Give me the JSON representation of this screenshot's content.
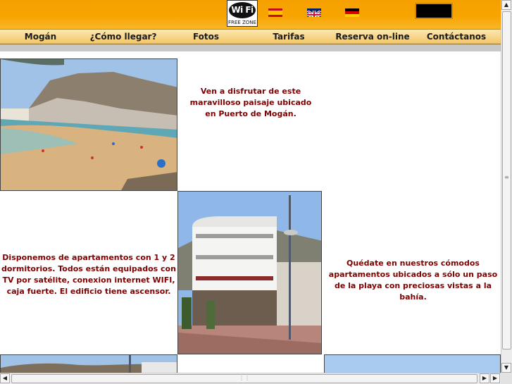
{
  "header": {
    "wifi": {
      "logo_text": "Wi Fi",
      "label": "FREE ZONE"
    },
    "languages": [
      {
        "name": "flag-spain-icon",
        "lang": "es"
      },
      {
        "name": "flag-uk-icon",
        "lang": "en"
      },
      {
        "name": "flag-germany-icon",
        "lang": "de"
      }
    ]
  },
  "nav": {
    "items": [
      {
        "label": "Mogán"
      },
      {
        "label": "¿Cómo llegar?"
      },
      {
        "label": "Fotos"
      },
      {
        "label": "Tarifas"
      },
      {
        "label": "Reserva on-line"
      },
      {
        "label": "Contáctanos"
      }
    ]
  },
  "content": {
    "intro": "Ven a disfrutar de este maravilloso paisaje ubicado en Puerto de Mogán.",
    "apartments": "Disponemos de apartamentos con 1 y 2 dormitorios. Todos están equipados con TV por satélite, conexion internet WIFI, caja fuerte. El edificio tiene ascensor.",
    "stay": "Quédate en nuestros cómodos apartamentos ubicados a sólo un paso de la playa con preciosas vistas a la bahía."
  },
  "colors": {
    "header_orange": "#f6a000",
    "nav_bg": "#f3c667",
    "text_maroon": "#800000"
  }
}
